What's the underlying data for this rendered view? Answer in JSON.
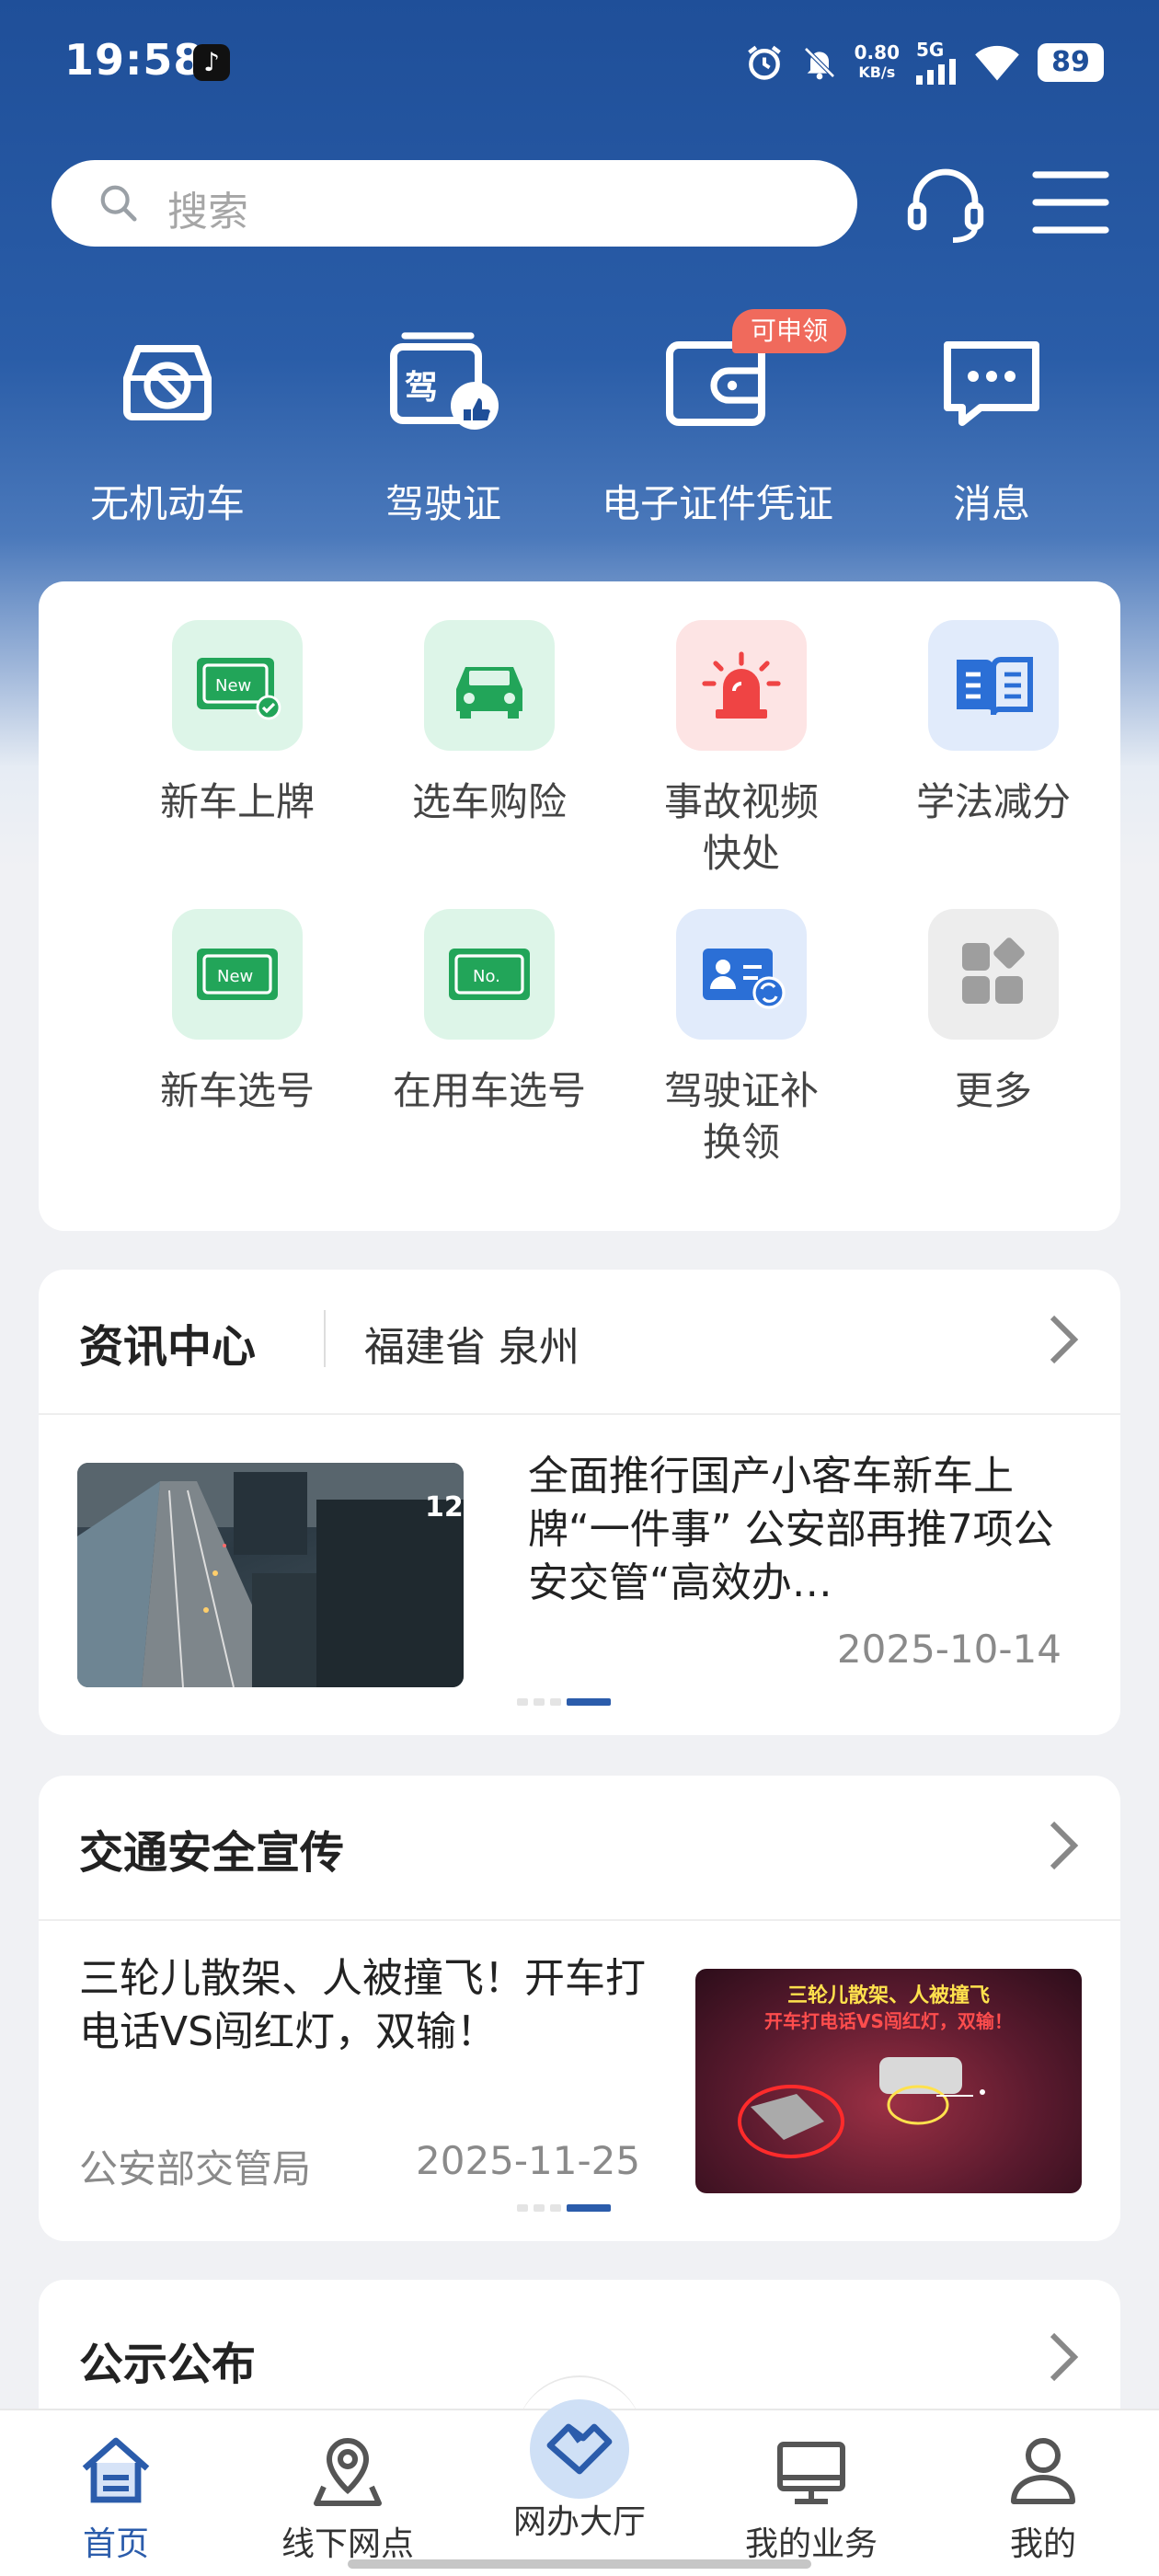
{
  "status_bar": {
    "time": "19:58",
    "net_speed_value": "0.80",
    "net_speed_unit": "KB/s",
    "network": "5G",
    "battery": "89"
  },
  "search": {
    "placeholder": "搜索"
  },
  "top_actions": [
    {
      "label": "无机动车",
      "icon": "no-vehicle-icon"
    },
    {
      "label": "驾驶证",
      "icon": "driving-license-icon"
    },
    {
      "label": "电子证件凭证",
      "icon": "wallet-icon",
      "badge": "可申领"
    },
    {
      "label": "消息",
      "icon": "message-icon"
    }
  ],
  "services": [
    {
      "label": "新车上牌",
      "icon": "new-plate-icon"
    },
    {
      "label": "选车购险",
      "icon": "car-insurance-icon"
    },
    {
      "label": "事故视频快处",
      "icon": "alarm-icon"
    },
    {
      "label": "学法减分",
      "icon": "book-icon"
    },
    {
      "label": "新车选号",
      "icon": "new-number-icon"
    },
    {
      "label": "在用车选号",
      "icon": "number-plate-icon"
    },
    {
      "label": "驾驶证补换领",
      "icon": "id-card-exchange-icon"
    },
    {
      "label": "更多",
      "icon": "more-grid-icon"
    }
  ],
  "news": {
    "title": "资讯中心",
    "location": "福建省 泉州",
    "article": {
      "title": "全面推行国产小客车新车上牌“一件事” 公安部再推7项公安交管“高效办…",
      "date": "2025-10-14",
      "thumb_overlay": "12"
    }
  },
  "safety": {
    "title": "交通安全宣传",
    "article": {
      "title": "三轮儿散架、人被撞飞！开车打电话VS闯红灯，双输！",
      "source": "公安部交管局",
      "date": "2025-11-25",
      "thumb_caption_1": "三轮儿散架、人被撞飞",
      "thumb_caption_2": "开车打电话VS闯红灯，双输！"
    }
  },
  "notice": {
    "title": "公示公布"
  },
  "tabs": [
    {
      "label": "首页",
      "icon": "home-icon",
      "active": true
    },
    {
      "label": "线下网点",
      "icon": "location-pin-icon"
    },
    {
      "label": "网办大厅",
      "icon": "handshake-icon"
    },
    {
      "label": "我的业务",
      "icon": "monitor-icon"
    },
    {
      "label": "我的",
      "icon": "person-icon"
    }
  ],
  "colors": {
    "brand_blue": "#1f4f99",
    "accent": "#2b5cab",
    "badge_red": "#f06a5c",
    "green_icon": "#16a34a",
    "red_icon": "#ef4444"
  }
}
